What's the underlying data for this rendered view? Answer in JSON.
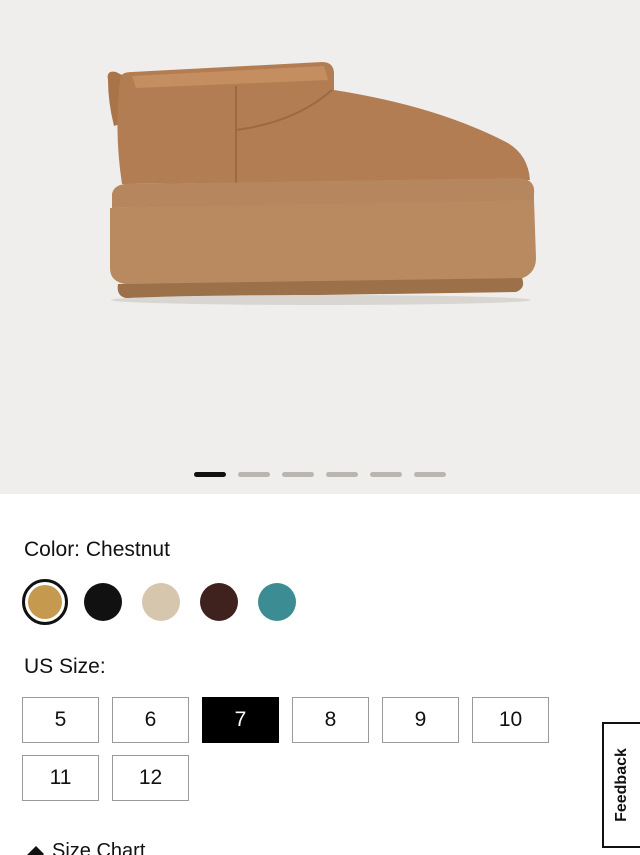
{
  "gallery": {
    "image_alt": "boot-image",
    "dot_count": 6,
    "active_dot": 0
  },
  "color": {
    "label": "Color: Chestnut",
    "swatches": [
      {
        "name": "chestnut",
        "hex": "#c59a4f",
        "selected": true
      },
      {
        "name": "black",
        "hex": "#111111",
        "selected": false
      },
      {
        "name": "sand",
        "hex": "#d6c6ae",
        "selected": false
      },
      {
        "name": "brown",
        "hex": "#3f211d",
        "selected": false
      },
      {
        "name": "teal",
        "hex": "#3b8c93",
        "selected": false
      }
    ]
  },
  "size": {
    "label": "US Size:",
    "options": [
      "5",
      "6",
      "7",
      "8",
      "9",
      "10",
      "11",
      "12"
    ],
    "selected": "7"
  },
  "size_chart": {
    "label": "Size Chart"
  },
  "feedback": {
    "label": "Feedback"
  }
}
